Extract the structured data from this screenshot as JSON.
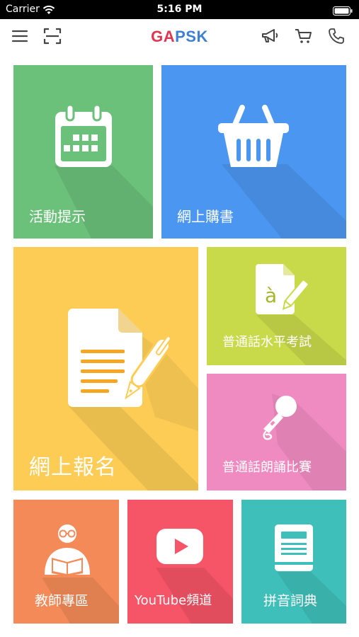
{
  "status_bar": {
    "carrier": "Carrier",
    "time": "5:16 PM"
  },
  "nav": {
    "logo_part1": "GA",
    "logo_part2": "PSK",
    "icons": [
      "menu-icon",
      "scan-icon",
      "megaphone-icon",
      "cart-icon",
      "phone-icon"
    ]
  },
  "tiles": {
    "events": {
      "label": "活動提示",
      "color": "#6cc17a",
      "icon": "calendar-icon"
    },
    "shop": {
      "label": "網上購書",
      "color": "#4b96f0",
      "icon": "basket-icon"
    },
    "register": {
      "label": "網上報名",
      "color": "#fdcc55",
      "icon": "document-pen-icon"
    },
    "exam": {
      "label": "普通話水平考試",
      "color": "#c8d94a",
      "icon": "language-doc-icon"
    },
    "recital": {
      "label": "普通話朗誦比賽",
      "color": "#f08bc1",
      "icon": "microphone-icon"
    },
    "teachers": {
      "label": "教師專區",
      "color": "#f48a57",
      "icon": "teacher-icon"
    },
    "youtube": {
      "label": "YouTube頻道",
      "color": "#f65467",
      "icon": "youtube-icon"
    },
    "dictionary": {
      "label": "拼音詞典",
      "color": "#3fbfb9",
      "icon": "book-icon"
    }
  }
}
